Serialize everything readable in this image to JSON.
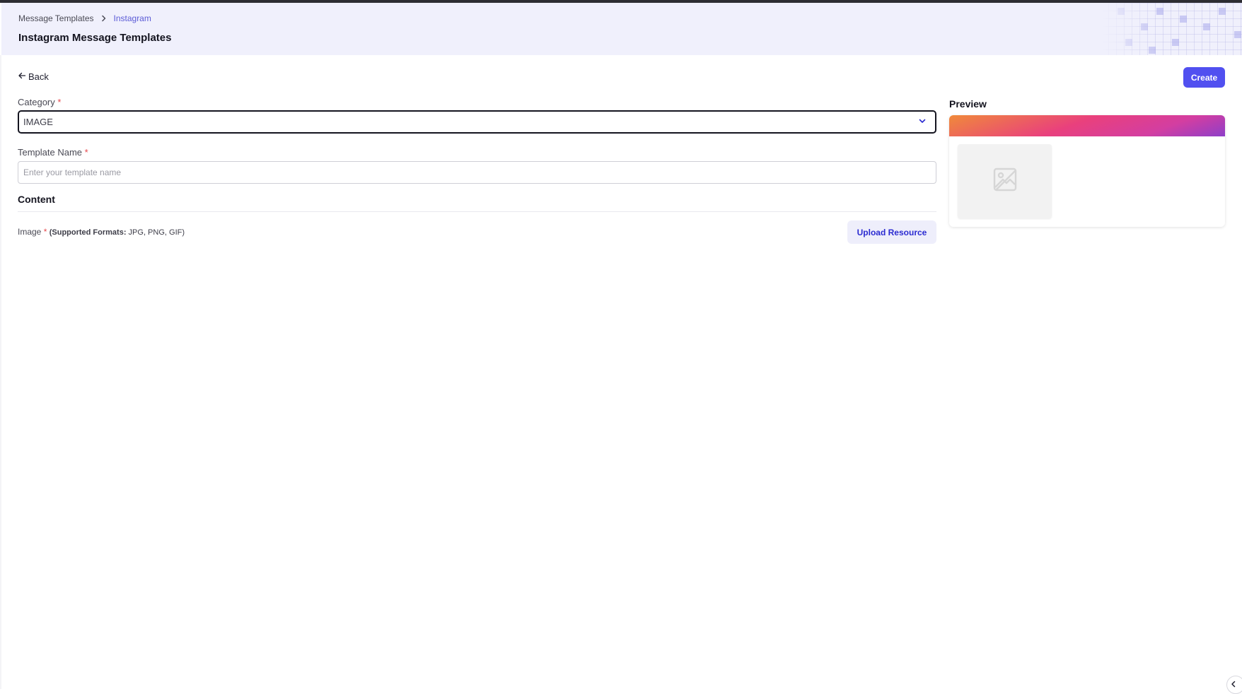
{
  "breadcrumb": {
    "parent": "Message Templates",
    "current": "Instagram"
  },
  "page": {
    "title": "Instagram Message Templates"
  },
  "toolbar": {
    "back_label": "Back",
    "create_label": "Create"
  },
  "form": {
    "category": {
      "label": "Category",
      "required_mark": "*",
      "value": "IMAGE"
    },
    "template_name": {
      "label": "Template Name",
      "required_mark": "*",
      "value": "",
      "placeholder": "Enter your template name"
    },
    "content": {
      "title": "Content",
      "image_label": "Image",
      "required_mark": "*",
      "formats_prefix": "(Supported Formats:",
      "formats_list": " JPG, PNG, GIF)",
      "upload_label": "Upload Resource"
    }
  },
  "preview": {
    "title": "Preview",
    "image_icon": "image-placeholder-icon"
  },
  "colors": {
    "accent": "#5150f0",
    "header_bg": "#f0f0fc",
    "required": "#e5484d",
    "link": "#5b5bd6"
  }
}
